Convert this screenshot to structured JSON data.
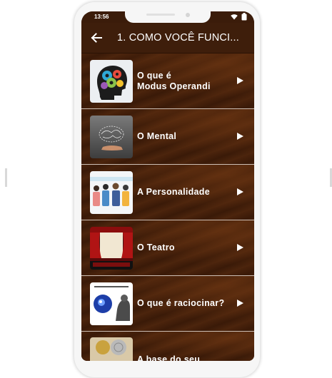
{
  "status": {
    "time": "13:56"
  },
  "app_bar": {
    "title": "1. COMO VOCÊ FUNCI..."
  },
  "items": [
    {
      "label_line1": "O que é",
      "label_line2": "Modus Operandi",
      "icon": "head-gears-icon"
    },
    {
      "label_line1": "O Mental",
      "label_line2": "",
      "icon": "brain-hand-icon"
    },
    {
      "label_line1": "A Personalidade",
      "label_line2": "",
      "icon": "people-group-icon"
    },
    {
      "label_line1": "O Teatro",
      "label_line2": "",
      "icon": "theater-stage-icon"
    },
    {
      "label_line1": "O que é raciocinar?",
      "label_line2": "",
      "icon": "thinker-brain-icon"
    },
    {
      "label_line1": "A base do seu",
      "label_line2": "",
      "icon": "brain-coins-icon"
    }
  ]
}
